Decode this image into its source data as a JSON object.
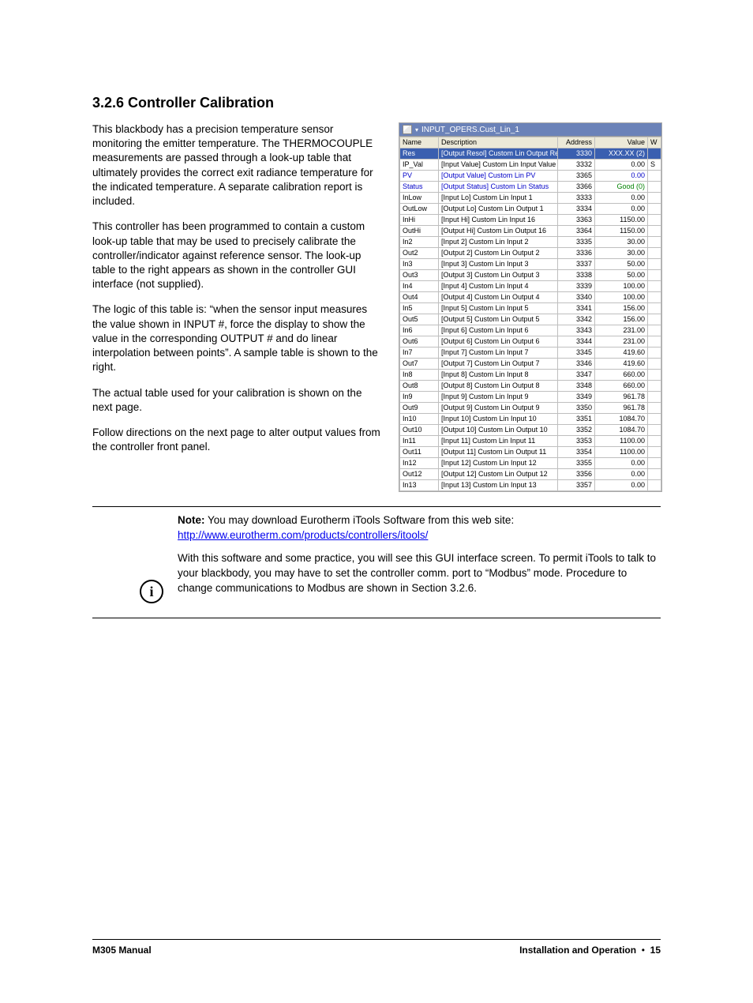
{
  "heading": "3.2.6  Controller Calibration",
  "paragraphs": [
    "This blackbody has a precision temperature sensor monitoring the emitter temperature. The THERMOCOUPLE measurements are passed through a look-up table that ultimately provides the correct exit radiance temperature for the indicated temperature. A separate calibration report is included.",
    "This controller has been programmed to contain a custom look-up table that may be used to precisely calibrate the controller/indicator against reference sensor.  The look-up table to the right appears as shown in the controller GUI interface (not supplied).",
    "The logic of this table is: “when the sensor input measures the value shown in INPUT #, force the display to show the value in the corresponding OUTPUT # and do linear interpolation between points”.  A sample table is shown to the right.",
    "The actual table used for your calibration is shown on the next page.",
    "Follow directions on the next page to alter output values from the controller front panel."
  ],
  "gui": {
    "title": "INPUT_OPERS.Cust_Lin_1",
    "headers": {
      "name": "Name",
      "desc": "Description",
      "addr": "Address",
      "val": "Value",
      "w": "W"
    },
    "rows": [
      {
        "name": "Res",
        "desc": "[Output Resol]  Custom Lin Output Resol",
        "addr": "3330",
        "val": "XXX.XX (2)",
        "sel": true
      },
      {
        "name": "IP_Val",
        "desc": "[Input Value]  Custom Lin Input Value",
        "addr": "3332",
        "val": "0.00",
        "trailing": "S"
      },
      {
        "name": "PV",
        "desc": "[Output Value]  Custom Lin PV",
        "addr": "3365",
        "val": "0.00",
        "cls": "blue"
      },
      {
        "name": "Status",
        "desc": "[Output Status]  Custom Lin Status",
        "addr": "3366",
        "val": "Good (0)",
        "cls": "blue",
        "valcls": "green"
      },
      {
        "name": "InLow",
        "desc": "[Input Lo]  Custom Lin Input 1",
        "addr": "3333",
        "val": "0.00"
      },
      {
        "name": "OutLow",
        "desc": "[Output Lo]  Custom Lin Output 1",
        "addr": "3334",
        "val": "0.00"
      },
      {
        "name": "InHi",
        "desc": "[Input Hi]  Custom Lin Input 16",
        "addr": "3363",
        "val": "1150.00"
      },
      {
        "name": "OutHi",
        "desc": "[Output Hi]  Custom Lin Output 16",
        "addr": "3364",
        "val": "1150.00"
      },
      {
        "name": "In2",
        "desc": "[Input 2]  Custom Lin Input 2",
        "addr": "3335",
        "val": "30.00"
      },
      {
        "name": "Out2",
        "desc": "[Output 2]  Custom Lin Output 2",
        "addr": "3336",
        "val": "30.00"
      },
      {
        "name": "In3",
        "desc": "[Input 3]  Custom Lin Input 3",
        "addr": "3337",
        "val": "50.00"
      },
      {
        "name": "Out3",
        "desc": "[Output 3]  Custom Lin Output 3",
        "addr": "3338",
        "val": "50.00"
      },
      {
        "name": "In4",
        "desc": "[Input 4]  Custom Lin Input 4",
        "addr": "3339",
        "val": "100.00"
      },
      {
        "name": "Out4",
        "desc": "[Output 4]  Custom Lin Output 4",
        "addr": "3340",
        "val": "100.00"
      },
      {
        "name": "In5",
        "desc": "[Input 5]  Custom Lin Input 5",
        "addr": "3341",
        "val": "156.00"
      },
      {
        "name": "Out5",
        "desc": "[Output 5]  Custom Lin Output 5",
        "addr": "3342",
        "val": "156.00"
      },
      {
        "name": "In6",
        "desc": "[Input 6]  Custom Lin Input 6",
        "addr": "3343",
        "val": "231.00"
      },
      {
        "name": "Out6",
        "desc": "[Output 6]  Custom Lin Output 6",
        "addr": "3344",
        "val": "231.00"
      },
      {
        "name": "In7",
        "desc": "[Input 7]  Custom Lin Input 7",
        "addr": "3345",
        "val": "419.60"
      },
      {
        "name": "Out7",
        "desc": "[Output 7]  Custom Lin Output 7",
        "addr": "3346",
        "val": "419.60"
      },
      {
        "name": "In8",
        "desc": "[Input 8]  Custom Lin Input 8",
        "addr": "3347",
        "val": "660.00"
      },
      {
        "name": "Out8",
        "desc": "[Output 8]  Custom Lin Output 8",
        "addr": "3348",
        "val": "660.00"
      },
      {
        "name": "In9",
        "desc": "[Input 9]  Custom Lin Input 9",
        "addr": "3349",
        "val": "961.78"
      },
      {
        "name": "Out9",
        "desc": "[Output 9]  Custom Lin Output 9",
        "addr": "3350",
        "val": "961.78"
      },
      {
        "name": "In10",
        "desc": "[Input 10]  Custom Lin Input 10",
        "addr": "3351",
        "val": "1084.70"
      },
      {
        "name": "Out10",
        "desc": "[Output 10]  Custom Lin Output 10",
        "addr": "3352",
        "val": "1084.70"
      },
      {
        "name": "In11",
        "desc": "[Input 11]  Custom Lin Input 11",
        "addr": "3353",
        "val": "1100.00"
      },
      {
        "name": "Out11",
        "desc": "[Output 11]  Custom Lin Output 11",
        "addr": "3354",
        "val": "1100.00"
      },
      {
        "name": "In12",
        "desc": "[Input 12]  Custom Lin Input 12",
        "addr": "3355",
        "val": "0.00"
      },
      {
        "name": "Out12",
        "desc": "[Output 12]  Custom Lin Output 12",
        "addr": "3356",
        "val": "0.00"
      },
      {
        "name": "In13",
        "desc": "[Input 13]  Custom Lin Input 13",
        "addr": "3357",
        "val": "0.00"
      }
    ]
  },
  "note": {
    "label": "Note:",
    "line1": " You may download Eurotherm iTools Software from this web site:",
    "link": "http://www.eurotherm.com/products/controllers/itools/",
    "para2": "With this software and some practice, you will see this GUI interface screen. To permit iTools to talk to your blackbody, you may have to set the controller comm. port to “Modbus” mode.  Procedure to change communications to Modbus are shown in Section 3.2.6."
  },
  "footer": {
    "left": "M305 Manual",
    "right_bold": "Installation and Operation",
    "right_tail": "15"
  }
}
